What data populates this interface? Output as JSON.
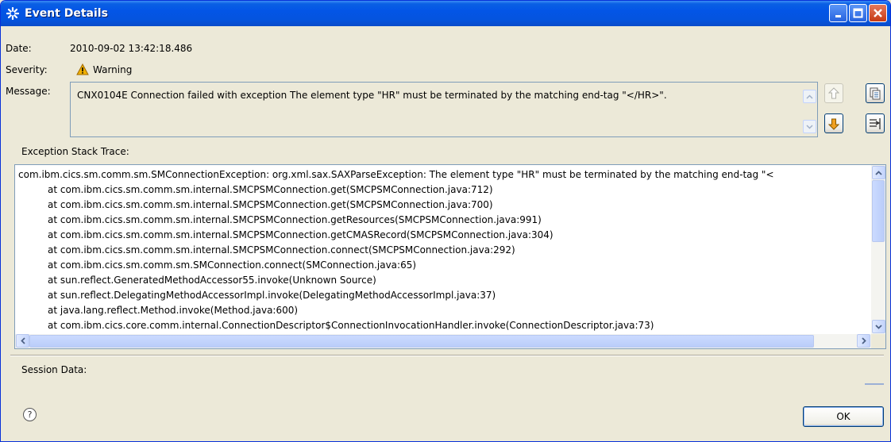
{
  "window": {
    "title": "Event Details"
  },
  "details": {
    "date_label": "Date:",
    "date_value": "2010-09-02 13:42:18.486",
    "severity_label": "Severity:",
    "severity_value": "Warning",
    "message_label": "Message:",
    "message_value": "CNX0104E Connection failed with exception The element type \"HR\" must be terminated by the matching end-tag \"</HR>\"."
  },
  "trace": {
    "label": "Exception Stack Trace:",
    "lines": [
      "com.ibm.cics.sm.comm.sm.SMConnectionException: org.xml.sax.SAXParseException: The element type \"HR\" must be terminated by the matching end-tag \"<",
      "at com.ibm.cics.sm.comm.sm.internal.SMCPSMConnection.get(SMCPSMConnection.java:712)",
      "at com.ibm.cics.sm.comm.sm.internal.SMCPSMConnection.get(SMCPSMConnection.java:700)",
      "at com.ibm.cics.sm.comm.sm.internal.SMCPSMConnection.getResources(SMCPSMConnection.java:991)",
      "at com.ibm.cics.sm.comm.sm.internal.SMCPSMConnection.getCMASRecord(SMCPSMConnection.java:304)",
      "at com.ibm.cics.sm.comm.sm.internal.SMCPSMConnection.connect(SMCPSMConnection.java:292)",
      "at com.ibm.cics.sm.comm.sm.SMConnection.connect(SMConnection.java:65)",
      "at sun.reflect.GeneratedMethodAccessor55.invoke(Unknown Source)",
      "at sun.reflect.DelegatingMethodAccessorImpl.invoke(DelegatingMethodAccessorImpl.java:37)",
      "at java.lang.reflect.Method.invoke(Method.java:600)",
      "at com.ibm.cics.core.comm.internal.ConnectionDescriptor$ConnectionInvocationHandler.invoke(ConnectionDescriptor.java:73)"
    ]
  },
  "session": {
    "label": "Session Data:"
  },
  "buttons": {
    "ok_label": "OK",
    "help_glyph": "?"
  },
  "icons": {
    "title": "gear-star-icon",
    "severity": "warning-icon",
    "previous": "arrow-up-icon",
    "next": "arrow-down-icon",
    "copy": "copy-icon",
    "filter": "filter-icon",
    "help": "help-icon"
  },
  "colors": {
    "titlebar": "#0355e6",
    "window_bg": "#ece9d8",
    "warning": "#f0b000",
    "next_arrow": "#f0a020"
  }
}
